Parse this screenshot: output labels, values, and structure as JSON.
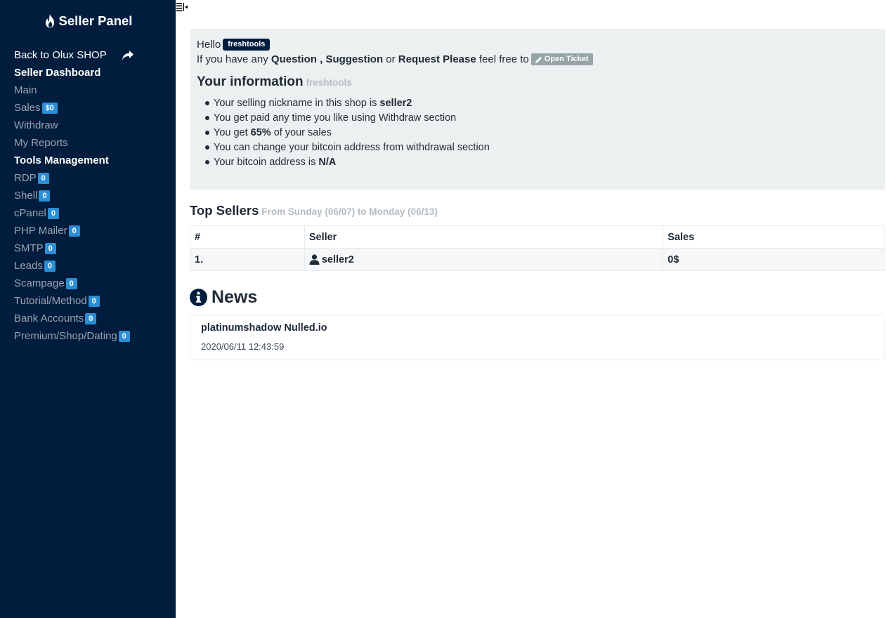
{
  "sidebar": {
    "brand": "Seller Panel",
    "back_link": "Back to Olux SHOP",
    "sections": [
      {
        "title": "Seller Dashboard",
        "items": [
          {
            "label": "Main",
            "badge": ""
          },
          {
            "label": "Sales",
            "badge": "$0"
          },
          {
            "label": "Withdraw",
            "badge": ""
          },
          {
            "label": "My Reports",
            "badge": ""
          }
        ]
      },
      {
        "title": "Tools Management",
        "items": [
          {
            "label": "RDP",
            "badge": "0"
          },
          {
            "label": "Shell",
            "badge": "0"
          },
          {
            "label": "cPanel",
            "badge": "0"
          },
          {
            "label": "PHP Mailer",
            "badge": "0"
          },
          {
            "label": "SMTP",
            "badge": "0"
          },
          {
            "label": "Leads",
            "badge": "0"
          },
          {
            "label": "Scampage",
            "badge": "0"
          },
          {
            "label": "Tutorial/Method",
            "badge": "0"
          },
          {
            "label": "Bank Accounts",
            "badge": "0"
          },
          {
            "label": "Premium/Shop/Dating",
            "badge": "0"
          }
        ]
      }
    ]
  },
  "greeting": {
    "hello": "Hello",
    "username": "freshtools",
    "line_prefix": "If you have any",
    "question": "Question",
    "comma": ",",
    "suggestion": "Suggestion",
    "or": "or",
    "request": "Request Please",
    "feel_free": "feel free to",
    "open_ticket": "Open Ticket"
  },
  "info": {
    "title": "Your information",
    "subtitle": "freshtools",
    "items": [
      {
        "pre": "Your selling nickname in this shop is",
        "bold": "seller2",
        "post": ""
      },
      {
        "pre": "You get paid any time you like using Withdraw section",
        "bold": "",
        "post": ""
      },
      {
        "pre": "You get",
        "bold": "65%",
        "post": "of your sales"
      },
      {
        "pre": "You can change your bitcoin address from withdrawal section",
        "bold": "",
        "post": ""
      },
      {
        "pre": "Your bitcoin address is",
        "bold": "N/A",
        "post": ""
      }
    ]
  },
  "top_sellers": {
    "title": "Top Sellers",
    "range": "From Sunday (06/07) to Monday (06/13)",
    "headers": [
      "#",
      "Seller",
      "Sales"
    ],
    "rows": [
      {
        "rank": "1.",
        "seller": "seller2",
        "sales": "0$"
      }
    ]
  },
  "news": {
    "title": "News",
    "items": [
      {
        "headline": "platinumshadow Nulled.io",
        "date": "2020/06/11 12:43:59"
      }
    ]
  },
  "colors": {
    "sidebar_bg": "#001d3d",
    "badge": "#2c8fd6",
    "jumbotron_bg": "#ecf0f1",
    "label_grey": "#95a5a6"
  }
}
